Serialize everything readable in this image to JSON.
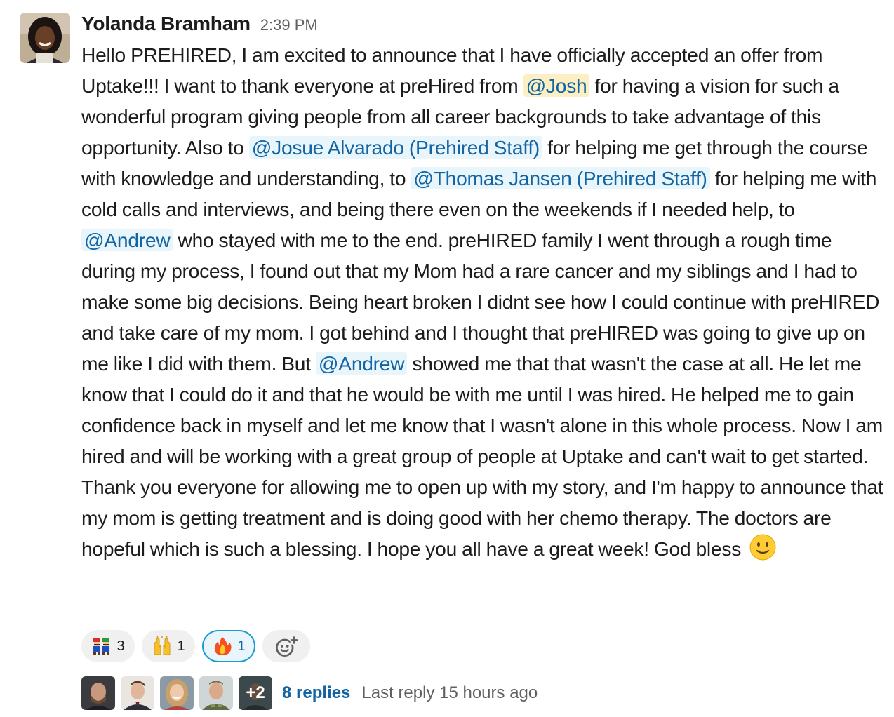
{
  "message": {
    "author": "Yolanda Bramham",
    "timestamp": "2:39 PM",
    "body": [
      {
        "type": "text",
        "text": "Hello PREHIRED, I am excited to announce that I have officially accepted an offer from Uptake!!!  I want to thank everyone at preHired from "
      },
      {
        "type": "mention_self",
        "text": "@Josh"
      },
      {
        "type": "text",
        "text": " for having a vision for such a wonderful program giving people from all career backgrounds to take advantage of this opportunity. Also to "
      },
      {
        "type": "mention",
        "text": "@Josue Alvarado (Prehired Staff)"
      },
      {
        "type": "text",
        "text": " for helping me get through the course with knowledge and understanding, to "
      },
      {
        "type": "mention",
        "text": "@Thomas Jansen (Prehired Staff)"
      },
      {
        "type": "text",
        "text": " for helping me with cold calls and interviews, and being there even on the weekends if I needed help, to "
      },
      {
        "type": "mention",
        "text": "@Andrew"
      },
      {
        "type": "text",
        "text": " who stayed with me to the end. preHIRED family I went through a rough time during my process, I found out that my Mom had a rare cancer and my siblings and I had to make some big decisions. Being heart broken I didnt see how I could continue with preHIRED and take care of my mom. I got behind and I thought that preHIRED was going to give up on me like I did with them. But "
      },
      {
        "type": "mention",
        "text": "@Andrew"
      },
      {
        "type": "text",
        "text": " showed me that that wasn't the case at all. He let me know that I could do it and that he would be with me until I was hired. He helped me to gain confidence back in myself and let me know that I wasn't alone in this whole process. Now I am hired and will be working with a great group of people at Uptake and can't wait to get started. Thank you everyone for allowing me to open up with my story, and I'm happy to announce that my mom is getting treatment and is doing good with her chemo therapy. The doctors are hopeful which is such a blessing. I hope you all have a great week! God bless "
      },
      {
        "type": "emoji",
        "icon": "slightly-smiling-face-icon"
      }
    ]
  },
  "reactions": [
    {
      "icon": "mario-luigi-icon",
      "count": "3",
      "active": false
    },
    {
      "icon": "raised-hands-icon",
      "count": "1",
      "active": false
    },
    {
      "icon": "fire-icon",
      "count": "1",
      "active": true
    }
  ],
  "add_reaction": {
    "icon": "add-reaction-icon"
  },
  "thread": {
    "more_label": "+2",
    "replies_label": "8 replies",
    "last_reply": "Last reply 15 hours ago"
  },
  "colors": {
    "mention_text": "#1264a3",
    "mention_bg": "#e8f5fa",
    "mention_self_bg": "#fdefc4",
    "active_reaction_border": "#1d9bd1"
  }
}
